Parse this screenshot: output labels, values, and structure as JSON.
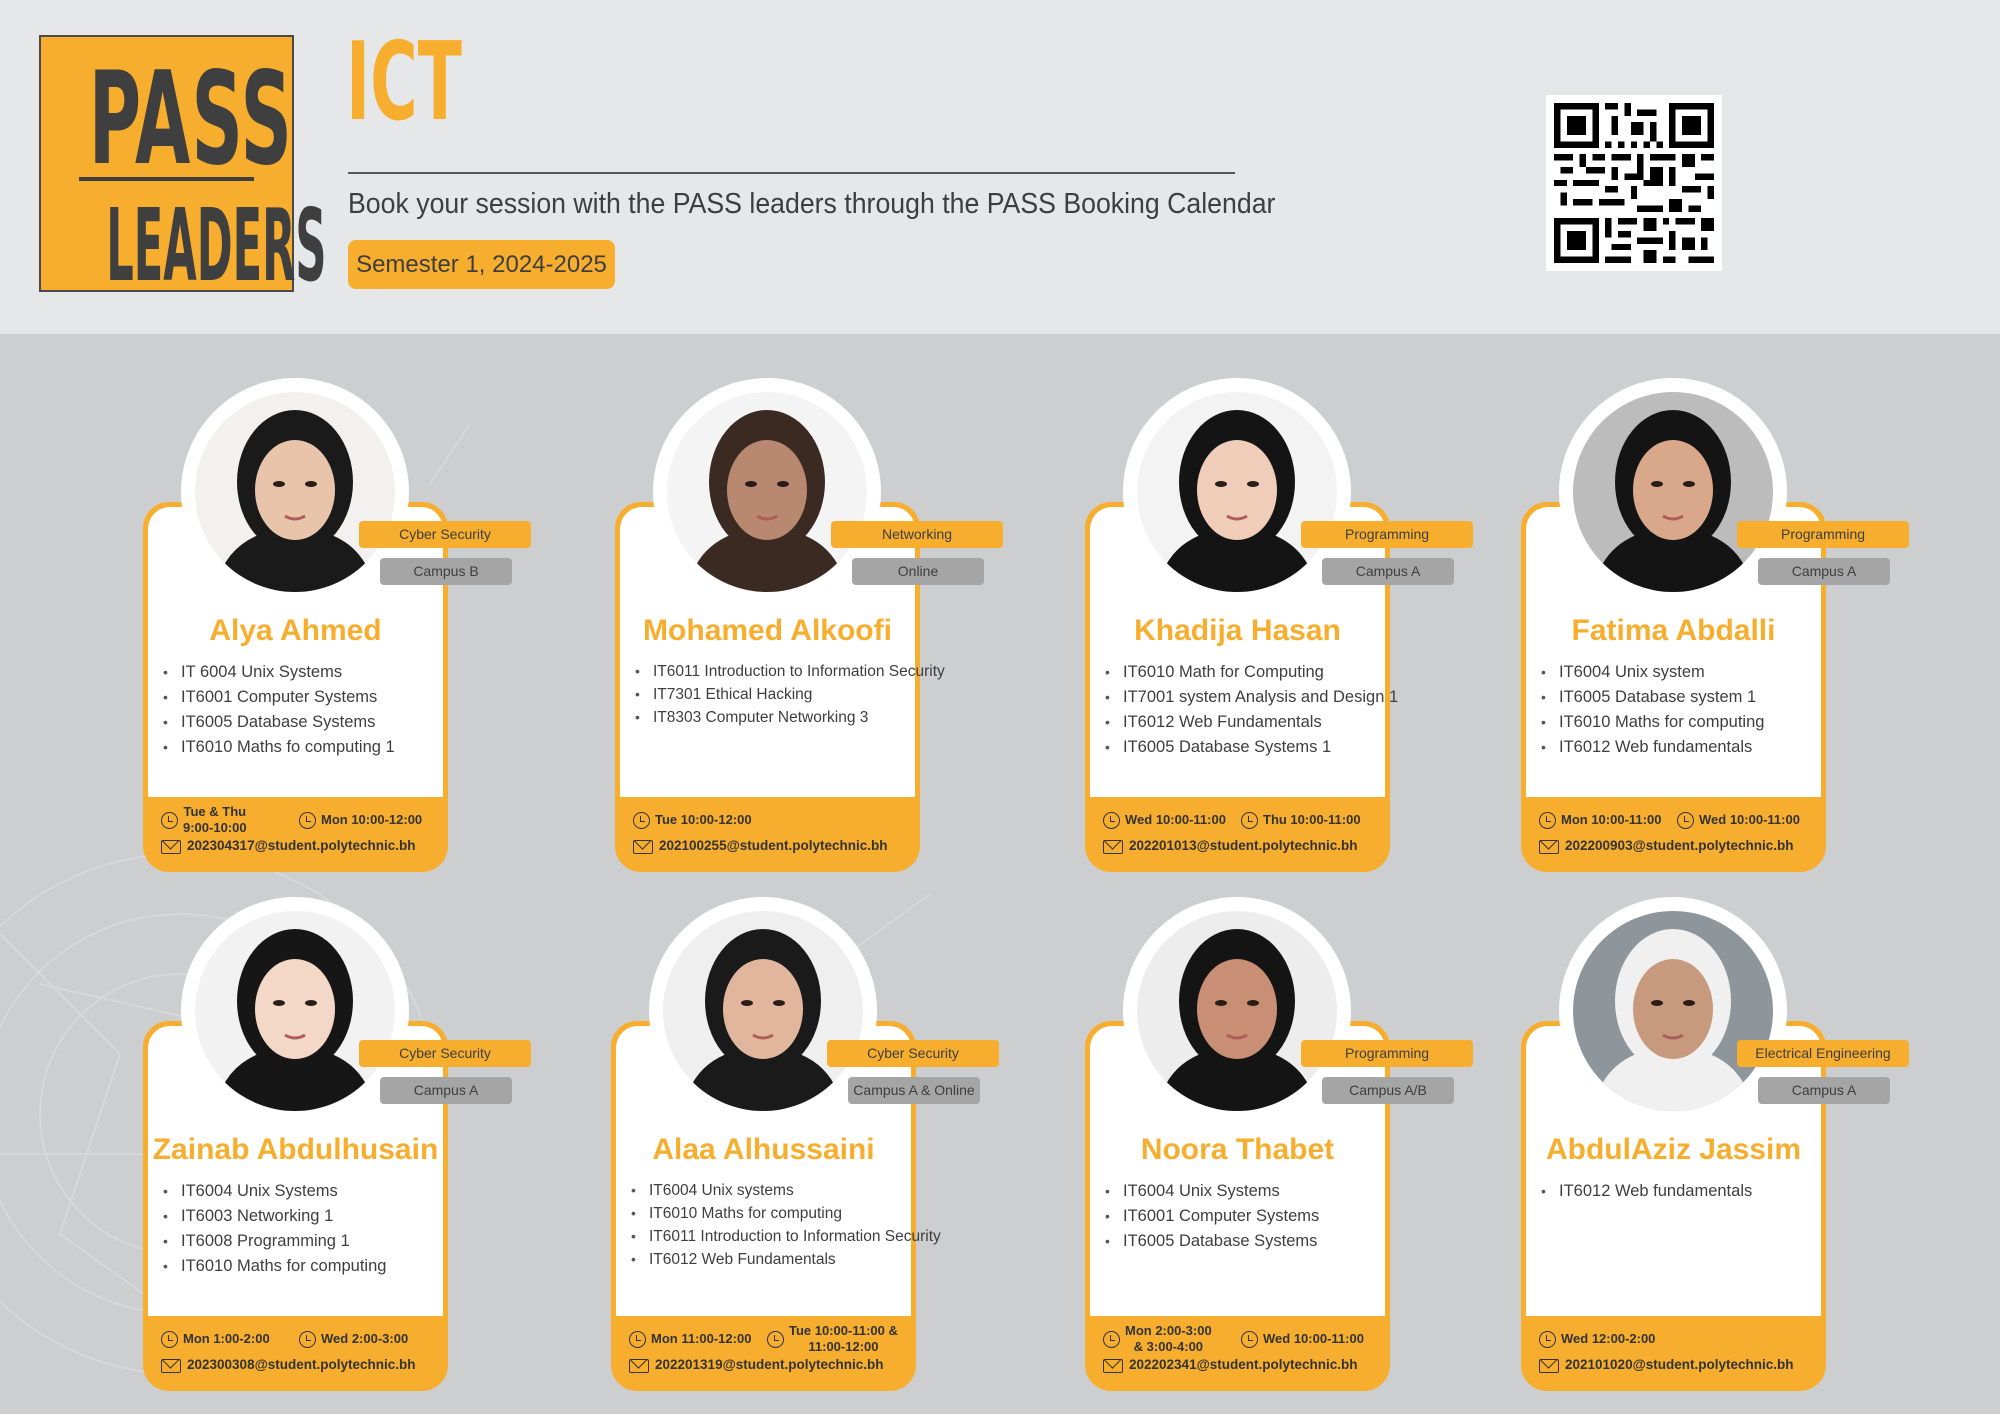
{
  "header": {
    "logo_line1": "PASS",
    "logo_line2": "LEADERS",
    "title": "ICT",
    "subtitle": "Book your session with the PASS leaders through the PASS Booking Calendar",
    "semester": "Semester 1, 2024-2025"
  },
  "colors": {
    "accent": "#f7ae2e",
    "dark_text": "#3e3e3e",
    "campus_tag": "#a5a5a5",
    "background": "#cdced0"
  },
  "leaders": [
    {
      "name": "Alya Ahmed",
      "subject": "Cyber Security",
      "campus": "Campus B",
      "courses": [
        "IT 6004 Unix Systems",
        "IT6001 Computer Systems",
        "IT6005 Database Systems",
        "IT6010 Maths fo computing 1"
      ],
      "slot1": "Tue & Thu\n9:00-10:00",
      "slot2": "Mon 10:00-12:00",
      "email": "202304317@student.polytechnic.bh"
    },
    {
      "name": "Mohamed Alkoofi",
      "subject": "Networking",
      "campus": "Online",
      "courses": [
        "IT6011 Introduction to Information Security",
        "IT7301 Ethical Hacking",
        "IT8303 Computer Networking 3"
      ],
      "slot1": "Tue 10:00-12:00",
      "slot2": "",
      "email": "202100255@student.polytechnic.bh"
    },
    {
      "name": "Khadija Hasan",
      "subject": "Programming",
      "campus": "Campus A",
      "courses": [
        "IT6010 Math for Computing",
        "IT7001 system Analysis and Design 1",
        "IT6012 Web Fundamentals",
        "IT6005 Database Systems 1"
      ],
      "slot1": "Wed 10:00-11:00",
      "slot2": "Thu 10:00-11:00",
      "email": "202201013@student.polytechnic.bh"
    },
    {
      "name": "Fatima Abdalli",
      "subject": "Programming",
      "campus": "Campus A",
      "courses": [
        "IT6004 Unix system",
        "IT6005 Database system 1",
        "IT6010 Maths for computing",
        "IT6012 Web fundamentals"
      ],
      "slot1": "Mon 10:00-11:00",
      "slot2": "Wed 10:00-11:00",
      "email": "202200903@student.polytechnic.bh"
    },
    {
      "name": "Zainab Abdulhusain",
      "subject": "Cyber Security",
      "campus": "Campus A",
      "courses": [
        "IT6004 Unix Systems",
        "IT6003 Networking 1",
        "IT6008 Programming 1",
        "IT6010 Maths for computing"
      ],
      "slot1": "Mon 1:00-2:00",
      "slot2": "Wed 2:00-3:00",
      "email": "202300308@student.polytechnic.bh"
    },
    {
      "name": "Alaa Alhussaini",
      "subject": "Cyber Security",
      "campus": "Campus A & Online",
      "courses": [
        "IT6004 Unix systems",
        "IT6010 Maths for computing",
        "IT6011 Introduction to Information Security",
        "IT6012 Web Fundamentals"
      ],
      "slot1": "Mon 11:00-12:00",
      "slot2": "Tue 10:00-11:00 &\n11:00-12:00",
      "email": "202201319@student.polytechnic.bh"
    },
    {
      "name": "Noora Thabet",
      "subject": "Programming",
      "campus": "Campus A/B",
      "courses": [
        "IT6004 Unix Systems",
        "IT6001 Computer Systems",
        "IT6005 Database Systems"
      ],
      "slot1": "Mon 2:00-3:00\n& 3:00-4:00",
      "slot2": "Wed 10:00-11:00",
      "email": "202202341@student.polytechnic.bh"
    },
    {
      "name": "AbdulAziz Jassim",
      "subject": "Electrical Engineering",
      "campus": "Campus A",
      "courses": [
        "IT6012 Web fundamentals"
      ],
      "slot1": "Wed 12:00-2:00",
      "slot2": "",
      "email": "202101020@student.polytechnic.bh"
    }
  ]
}
